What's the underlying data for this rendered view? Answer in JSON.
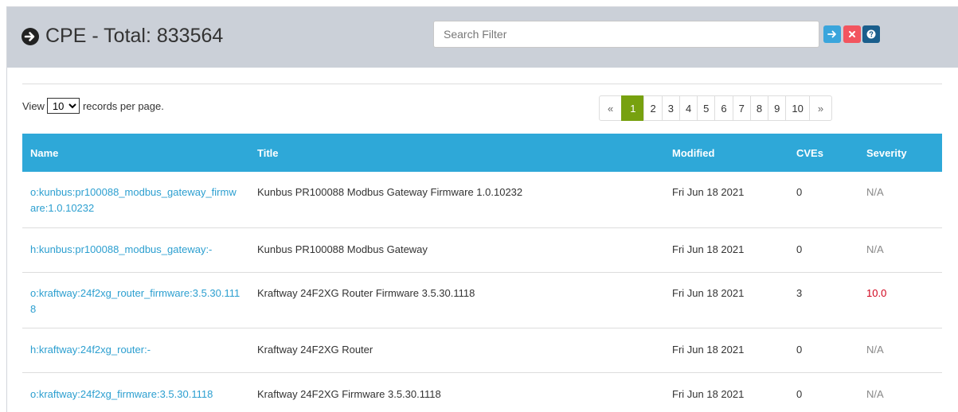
{
  "header": {
    "title": "CPE - Total: 833564",
    "search": {
      "placeholder": "Search Filter",
      "value": ""
    },
    "buttons": {
      "go_icon": "arrow-right-icon",
      "clear_icon": "close-icon",
      "help_icon": "question-icon"
    }
  },
  "controls": {
    "view_prefix": "View",
    "per_page_selected": "10",
    "view_suffix": "records per page."
  },
  "pagination": {
    "prev": "«",
    "pages": [
      "1",
      "2",
      "3",
      "4",
      "5",
      "6",
      "7",
      "8",
      "9",
      "10"
    ],
    "active": "1",
    "next": "»"
  },
  "table": {
    "columns": [
      "Name",
      "Title",
      "Modified",
      "CVEs",
      "Severity"
    ],
    "rows": [
      {
        "name": "o:kunbus:pr100088_modbus_gateway_firmware:1.0.10232",
        "title": "Kunbus PR100088 Modbus Gateway Firmware 1.0.10232",
        "modified": "Fri Jun 18 2021",
        "cves": "0",
        "severity": "N/A"
      },
      {
        "name": "h:kunbus:pr100088_modbus_gateway:-",
        "title": "Kunbus PR100088 Modbus Gateway",
        "modified": "Fri Jun 18 2021",
        "cves": "0",
        "severity": "N/A"
      },
      {
        "name": "o:kraftway:24f2xg_router_firmware:3.5.30.1118",
        "title": "Kraftway 24F2XG Router Firmware 3.5.30.1118",
        "modified": "Fri Jun 18 2021",
        "cves": "3",
        "severity": "10.0"
      },
      {
        "name": "h:kraftway:24f2xg_router:-",
        "title": "Kraftway 24F2XG Router",
        "modified": "Fri Jun 18 2021",
        "cves": "0",
        "severity": "N/A"
      },
      {
        "name": "o:kraftway:24f2xg_firmware:3.5.30.1118",
        "title": "Kraftway 24F2XG Firmware 3.5.30.1118",
        "modified": "Fri Jun 18 2021",
        "cves": "0",
        "severity": "N/A"
      }
    ]
  },
  "colors": {
    "header_bg": "#cbd0d8",
    "table_header": "#2ea8d8",
    "active_page": "#77a10f",
    "link": "#2c9fd0",
    "severity_high": "#d0021b"
  }
}
